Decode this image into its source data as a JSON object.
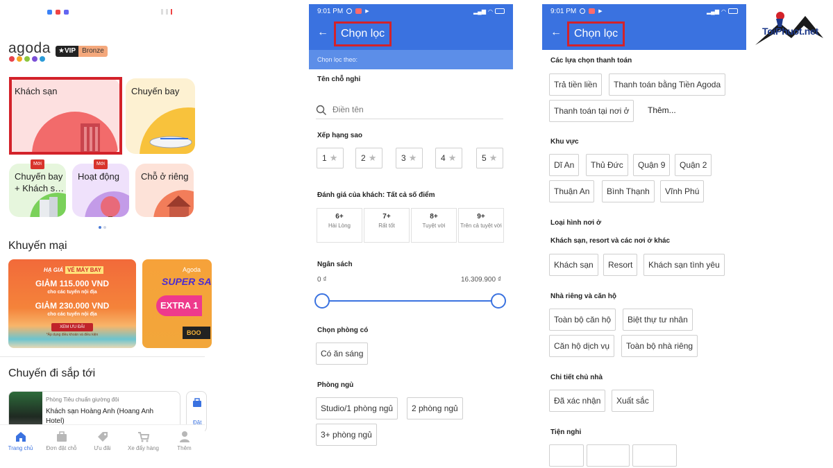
{
  "panel_home": {
    "logo": "agoda",
    "vip": {
      "label": "★VIP",
      "tier": "Bronze"
    },
    "tiles": [
      {
        "label": "Khách sạn"
      },
      {
        "label": "Chuyến bay"
      },
      {
        "label": "Chuyến bay + Khách s…",
        "badge": "Mới"
      },
      {
        "label": "Hoạt động",
        "badge": "Mới"
      },
      {
        "label": "Chỗ ở riêng"
      }
    ],
    "promotions_title": "Khuyến mại",
    "promo1": {
      "tag_left": "HẠ GIÁ",
      "tag_right": "VÉ MÁY BAY",
      "line1": "GIẢM 115.000 VND",
      "line2": "cho các tuyến nội địa",
      "line3": "GIẢM 230.000 VND",
      "line4": "cho các tuyến nội địa",
      "cta": "XEM ƯU ĐÃI",
      "terms": "*Áp dụng điều khoản và điều kiện"
    },
    "promo2": {
      "brand": "Agoda",
      "title": "SUPER SA",
      "extra": "EXTRA 1",
      "cta": "BOO"
    },
    "upcoming_title": "Chuyến đi sắp tới",
    "trip": {
      "room": "Phòng Tiêu chuẩn giường đôi",
      "hotel": "Khách sạn Hoàng Anh (Hoang Anh Hotel)",
      "side_label": "Đặt"
    },
    "nav": [
      {
        "label": "Trang chủ",
        "icon": "home-icon"
      },
      {
        "label": "Đơn đặt chỗ",
        "icon": "briefcase-icon"
      },
      {
        "label": "Ưu đãi",
        "icon": "tag-icon"
      },
      {
        "label": "Xe đẩy hàng",
        "icon": "cart-icon"
      },
      {
        "label": "Thêm",
        "icon": "person-icon"
      }
    ]
  },
  "status": {
    "time": "9:01 PM"
  },
  "filter_a": {
    "title": "Chọn lọc",
    "subtitle": "Chọn lọc theo:",
    "name_label": "Tên chỗ nghỉ",
    "name_placeholder": "Điền tên",
    "stars_label": "Xếp hạng sao",
    "stars": [
      "1",
      "2",
      "3",
      "4",
      "5"
    ],
    "review_label": "Đánh giá của khách: Tất cả số điểm",
    "scores": [
      {
        "n": "6+",
        "d": "Hài Lòng"
      },
      {
        "n": "7+",
        "d": "Rất tốt"
      },
      {
        "n": "8+",
        "d": "Tuyệt vời"
      },
      {
        "n": "9+",
        "d": "Trên cả tuyệt vời"
      }
    ],
    "budget_label": "Ngân sách",
    "budget_min": "0 ₫",
    "budget_max": "16.309.900 ₫",
    "room_label": "Chọn phòng có",
    "room_options": [
      "Có ăn sáng"
    ],
    "bedroom_label": "Phòng ngủ",
    "bedrooms": [
      "Studio/1 phòng ngủ",
      "2 phòng ngủ",
      "3+ phòng ngủ"
    ]
  },
  "filter_b": {
    "title": "Chọn lọc",
    "payment_label": "Các lựa chọn thanh toán",
    "payments": [
      "Trả tiền liền",
      "Thanh toán bằng Tiền Agoda",
      "Thanh toán tại nơi ở"
    ],
    "more": "Thêm...",
    "area_label": "Khu vực",
    "areas": [
      "Dĩ An",
      "Thủ Đức",
      "Quận 9",
      "Quận 2",
      "Thuận An",
      "Bình Thạnh",
      "Vĩnh Phú"
    ],
    "type_label": "Loại hình nơi ở",
    "type_sub1": "Khách sạn, resort và các nơi ở khác",
    "types1": [
      "Khách sạn",
      "Resort",
      "Khách sạn tình yêu"
    ],
    "type_sub2": "Nhà riêng và căn hộ",
    "types2": [
      "Toàn bộ căn hộ",
      "Biệt thự tư nhân",
      "Căn hộ dịch vụ",
      "Toàn bộ nhà riêng"
    ],
    "host_label": "Chi tiết chủ nhà",
    "hosts": [
      "Đã xác nhận",
      "Xuất sắc"
    ],
    "amenities_label": "Tiện nghi"
  },
  "watermark": "ToiPhuot.net",
  "colors": {
    "brand_blue": "#3a72e0",
    "highlight_red": "#d3222a"
  }
}
